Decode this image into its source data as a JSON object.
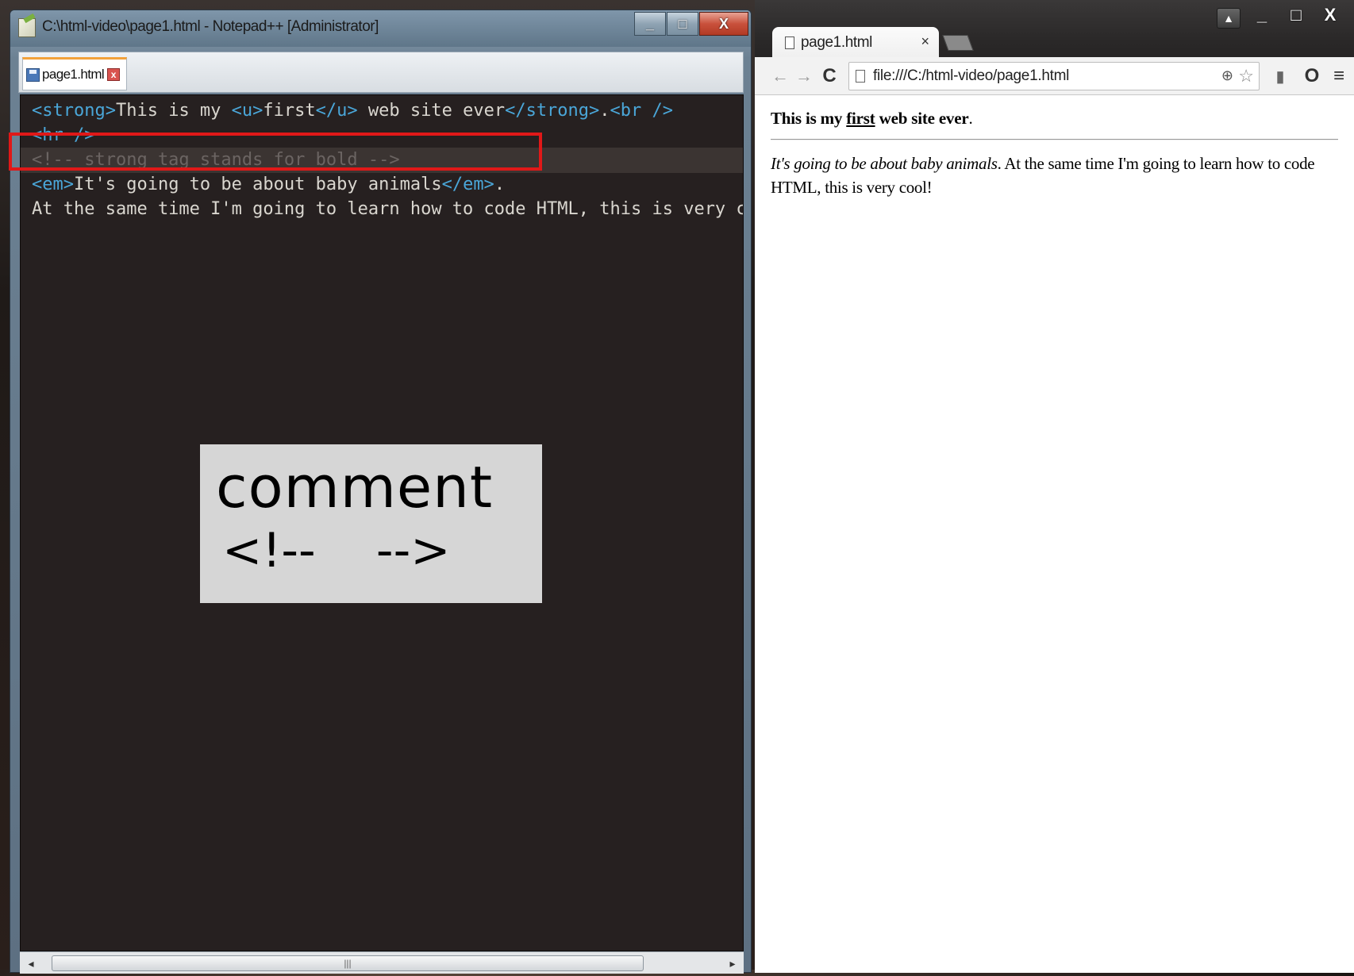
{
  "notepad": {
    "window_title": "C:\\html-video\\page1.html - Notepad++ [Administrator]",
    "window_buttons": {
      "minimize": "_",
      "maximize": "□",
      "close": "X"
    },
    "tab": {
      "label": "page1.html",
      "close": "x"
    },
    "code_lines": [
      {
        "segments": [
          {
            "text": "<strong>",
            "kind": "tag"
          },
          {
            "text": "This is my ",
            "kind": "text"
          },
          {
            "text": "<u>",
            "kind": "tag"
          },
          {
            "text": "first",
            "kind": "text"
          },
          {
            "text": "</u>",
            "kind": "tag"
          },
          {
            "text": " web site ever",
            "kind": "text"
          },
          {
            "text": "</strong>",
            "kind": "tag"
          },
          {
            "text": ".",
            "kind": "text"
          },
          {
            "text": "<br />",
            "kind": "tag"
          }
        ]
      },
      {
        "segments": [
          {
            "text": "<hr />",
            "kind": "tag"
          }
        ]
      },
      {
        "segments": [
          {
            "text": "<!-- strong tag stands for bold -->",
            "kind": "comment"
          }
        ]
      },
      {
        "segments": [
          {
            "text": "<em>",
            "kind": "tag"
          },
          {
            "text": "It's going to be about baby animals",
            "kind": "text"
          },
          {
            "text": "</em>",
            "kind": "tag"
          },
          {
            "text": ".",
            "kind": "text"
          }
        ]
      },
      {
        "segments": [
          {
            "text": "At the same time I'm going to learn how to code HTML, this is very cool!",
            "kind": "text"
          }
        ]
      }
    ],
    "overlay_card": {
      "title": "comment",
      "syntax": "<!--    -->"
    },
    "scrollbar": {
      "left_arrow": "◂",
      "right_arrow": "▸",
      "grip": "|||"
    }
  },
  "browser": {
    "tab_title": "page1.html",
    "tab_close": "×",
    "url": "file:///C:/html-video/page1.html",
    "window_buttons": {
      "minimize": "_",
      "maximize": "□",
      "close": "X"
    },
    "toolbar": {
      "back": "←",
      "forward": "→",
      "reload": "C",
      "zoom": "⊕",
      "star": "☆",
      "menu": "≡"
    },
    "content": {
      "heading_before": "This is my ",
      "heading_underlined": "first",
      "heading_after": " web site ever",
      "heading_period": ".",
      "para_italic": "It's going to be about baby animals",
      "para_rest": ". At the same time I'm going to learn how to code HTML, this is very cool!"
    }
  },
  "colors": {
    "editor_background": "#262020",
    "tag_color": "#4aa6d8",
    "text_color": "#d9d6cf",
    "comment_color": "#6b6462",
    "highlight_border": "#e01818"
  }
}
